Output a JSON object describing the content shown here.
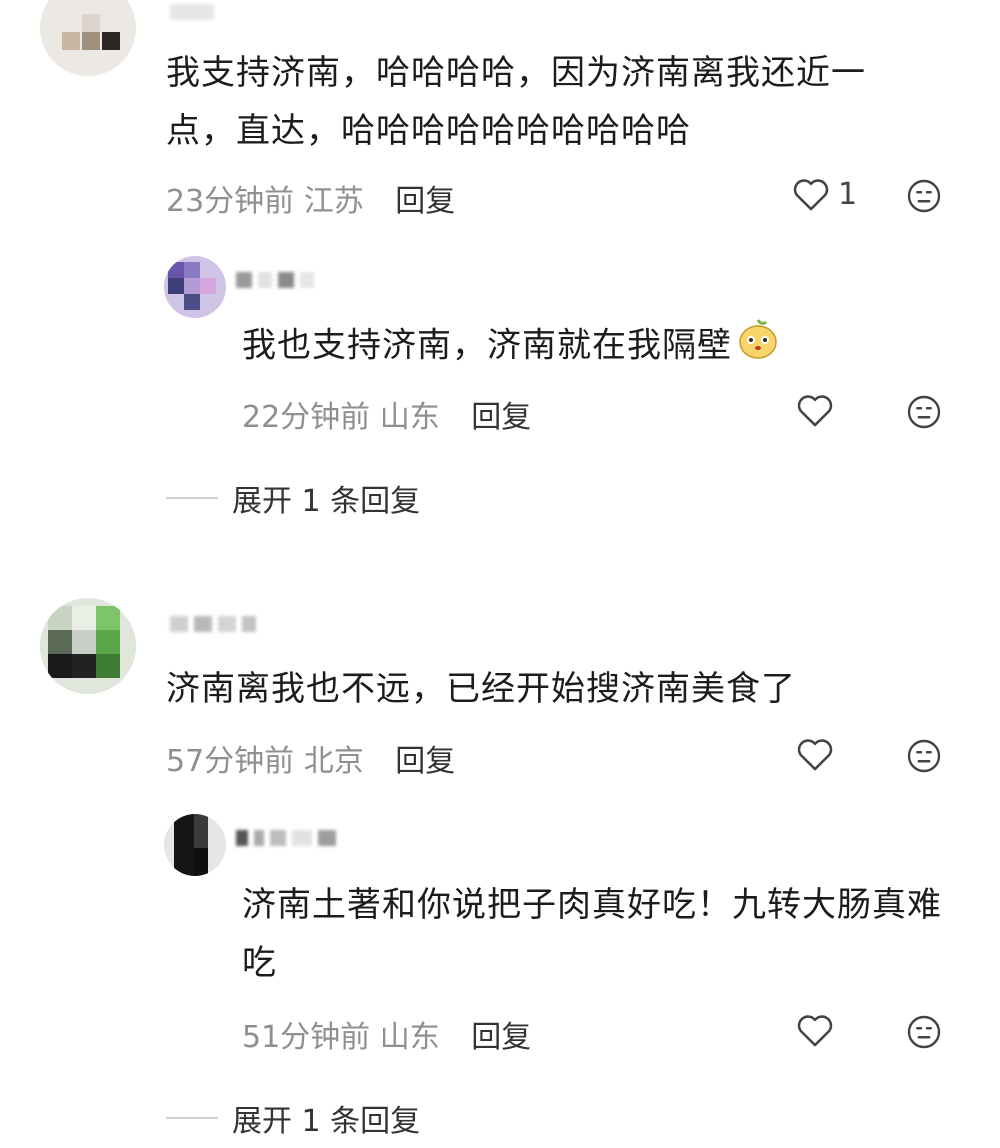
{
  "comments": [
    {
      "text": "我支持济南，哈哈哈哈，因为济南离我还近一点，直达，哈哈哈哈哈哈哈哈哈哈",
      "time": "23分钟前",
      "location": "江苏",
      "reply_label": "回复",
      "likes": "1",
      "replies": [
        {
          "text": "我也支持济南，济南就在我隔壁",
          "time": "22分钟前",
          "location": "山东",
          "reply_label": "回复"
        }
      ],
      "expand_label": "展开 1 条回复"
    },
    {
      "text": "济南离我也不远，已经开始搜济南美食了",
      "time": "57分钟前",
      "location": "北京",
      "reply_label": "回复",
      "replies": [
        {
          "text": "济南土著和你说把子肉真好吃！九转大肠真难吃",
          "time": "51分钟前",
          "location": "山东",
          "reply_label": "回复"
        }
      ],
      "expand_label": "展开 1 条回复"
    }
  ],
  "icons": [
    "heart-outline-icon",
    "dislike-face-icon",
    "mascot-emoji-icon"
  ],
  "colors": {
    "text": "#1c1c1c",
    "meta": "#8f8f8f",
    "reply": "#333333"
  }
}
